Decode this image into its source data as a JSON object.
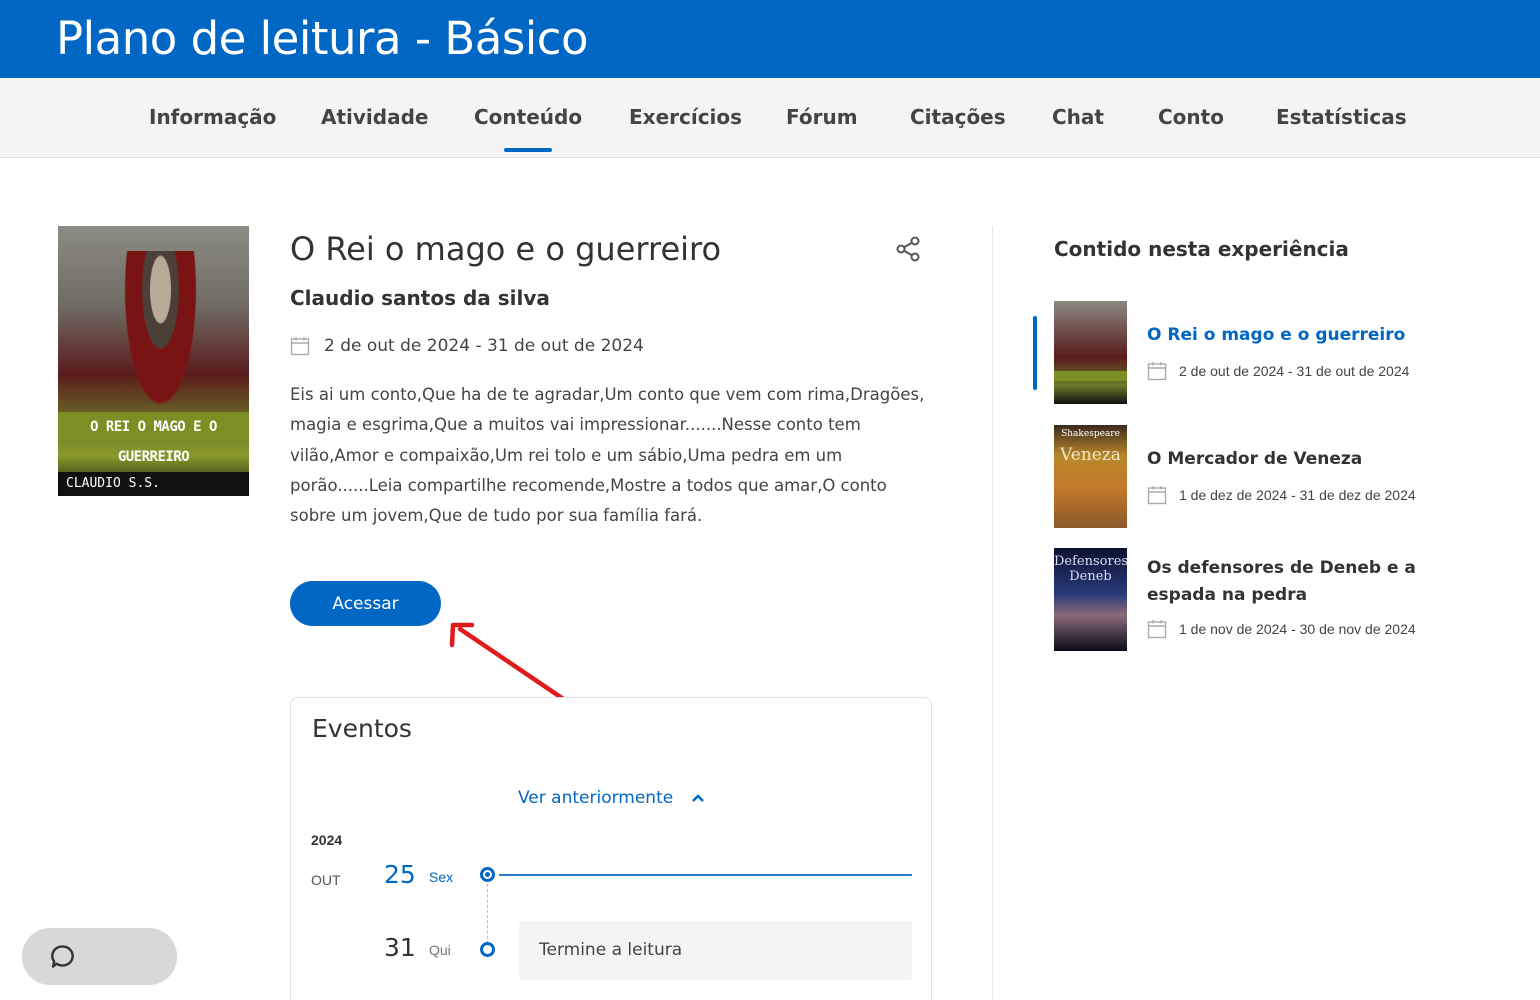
{
  "header": {
    "title": "Plano de leitura - Básico"
  },
  "tabs": [
    {
      "label": "Informação"
    },
    {
      "label": "Atividade"
    },
    {
      "label": "Conteúdo",
      "active": true
    },
    {
      "label": "Exercícios"
    },
    {
      "label": "Fórum"
    },
    {
      "label": "Citações"
    },
    {
      "label": "Chat"
    },
    {
      "label": "Conto"
    },
    {
      "label": "Estatísticas"
    }
  ],
  "book": {
    "cover_title": "O REI O MAGO E O GUERREIRO",
    "cover_author": "CLAUDIO S.S.",
    "title": "O Rei o mago e o guerreiro",
    "author": "Claudio santos da silva",
    "dates": "2 de out de 2024 - 31 de out de 2024",
    "description": "Eis ai um conto,Que ha de te agradar,Um conto que vem com rima,Dragões, magia e esgrima,Que a muitos vai impressionar.......Nesse conto tem vilão,Amor e compaixão,Um rei tolo e um sábio,Uma pedra em um porão......Leia compartilhe recomende,Mostre a todos que amar,O conto sobre um jovem,Que de tudo por sua família fará.",
    "access_label": "Acessar"
  },
  "events": {
    "title": "Eventos",
    "see_earlier": "Ver anteriormente",
    "year": "2024",
    "month": "OUT",
    "days": [
      {
        "num": "25",
        "name": "Sex"
      },
      {
        "num": "31",
        "name": "Qui"
      }
    ],
    "task": "Termine a leitura"
  },
  "sidebar": {
    "title": "Contido nesta experiência",
    "items": [
      {
        "name": "O Rei o mago e o guerreiro",
        "dates": "2 de out de 2024 - 31 de out de 2024",
        "active": true
      },
      {
        "name": "O Mercador de Veneza",
        "dates": "1 de dez de 2024 - 31 de dez de 2024",
        "thumb_top": "Shakespeare",
        "thumb_title": "Veneza"
      },
      {
        "name": "Os defensores de Deneb e a espada na pedra",
        "dates": "1 de nov de 2024 - 30 de nov de 2024",
        "thumb_title": "Defensores Deneb"
      }
    ]
  },
  "colors": {
    "brand": "#0067c5",
    "arrow": "#e01b1b"
  }
}
